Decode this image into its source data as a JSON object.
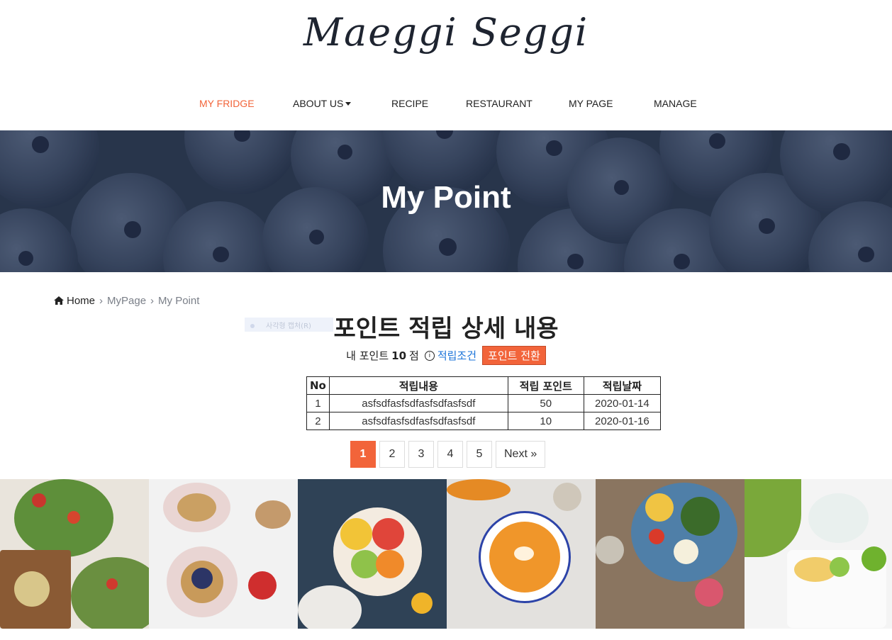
{
  "brand": {
    "logo": "Maeggi Seggi"
  },
  "nav": {
    "items": [
      {
        "label": "MY FRIDGE",
        "active": true
      },
      {
        "label": "ABOUT US",
        "dropdown": true
      },
      {
        "label": "RECIPE"
      },
      {
        "label": "RESTAURANT"
      },
      {
        "label": "MY PAGE"
      },
      {
        "label": "MANAGE"
      }
    ]
  },
  "hero": {
    "title": "My Point"
  },
  "breadcrumb": {
    "home": "Home",
    "items": [
      "MyPage",
      "My Point"
    ]
  },
  "ghost_tooltip": "사각형 캡처(R)",
  "page": {
    "heading": "포인트 적립 상세 내용",
    "points_prefix": "내 포인트",
    "points_value": "10",
    "points_unit": "점",
    "conditions_link": "적립조건",
    "convert_button": "포인트 전환"
  },
  "table": {
    "headers": [
      "No",
      "적립내용",
      "적립 포인트",
      "적립날짜"
    ],
    "rows": [
      [
        "1",
        "asfsdfasfsdfasfsdfasfsdf",
        "50",
        "2020-01-14"
      ],
      [
        "2",
        "asfsdfasfsdfasfsdfasfsdf",
        "10",
        "2020-01-16"
      ]
    ]
  },
  "pagination": {
    "pages": [
      "1",
      "2",
      "3",
      "4",
      "5"
    ],
    "current": "1",
    "next": "Next »"
  },
  "colors": {
    "accent": "#f2643a",
    "link": "#1a73d9",
    "hero": "#33425a"
  },
  "icons": {
    "home": "home-icon",
    "info": "info-icon",
    "caret": "caret-down-icon"
  },
  "gallery": [
    "salad-photo",
    "waffle-photo",
    "fruit-bowl-photo",
    "pumpkin-soup-photo",
    "veggie-bowl-photo",
    "toast-plate-photo"
  ]
}
